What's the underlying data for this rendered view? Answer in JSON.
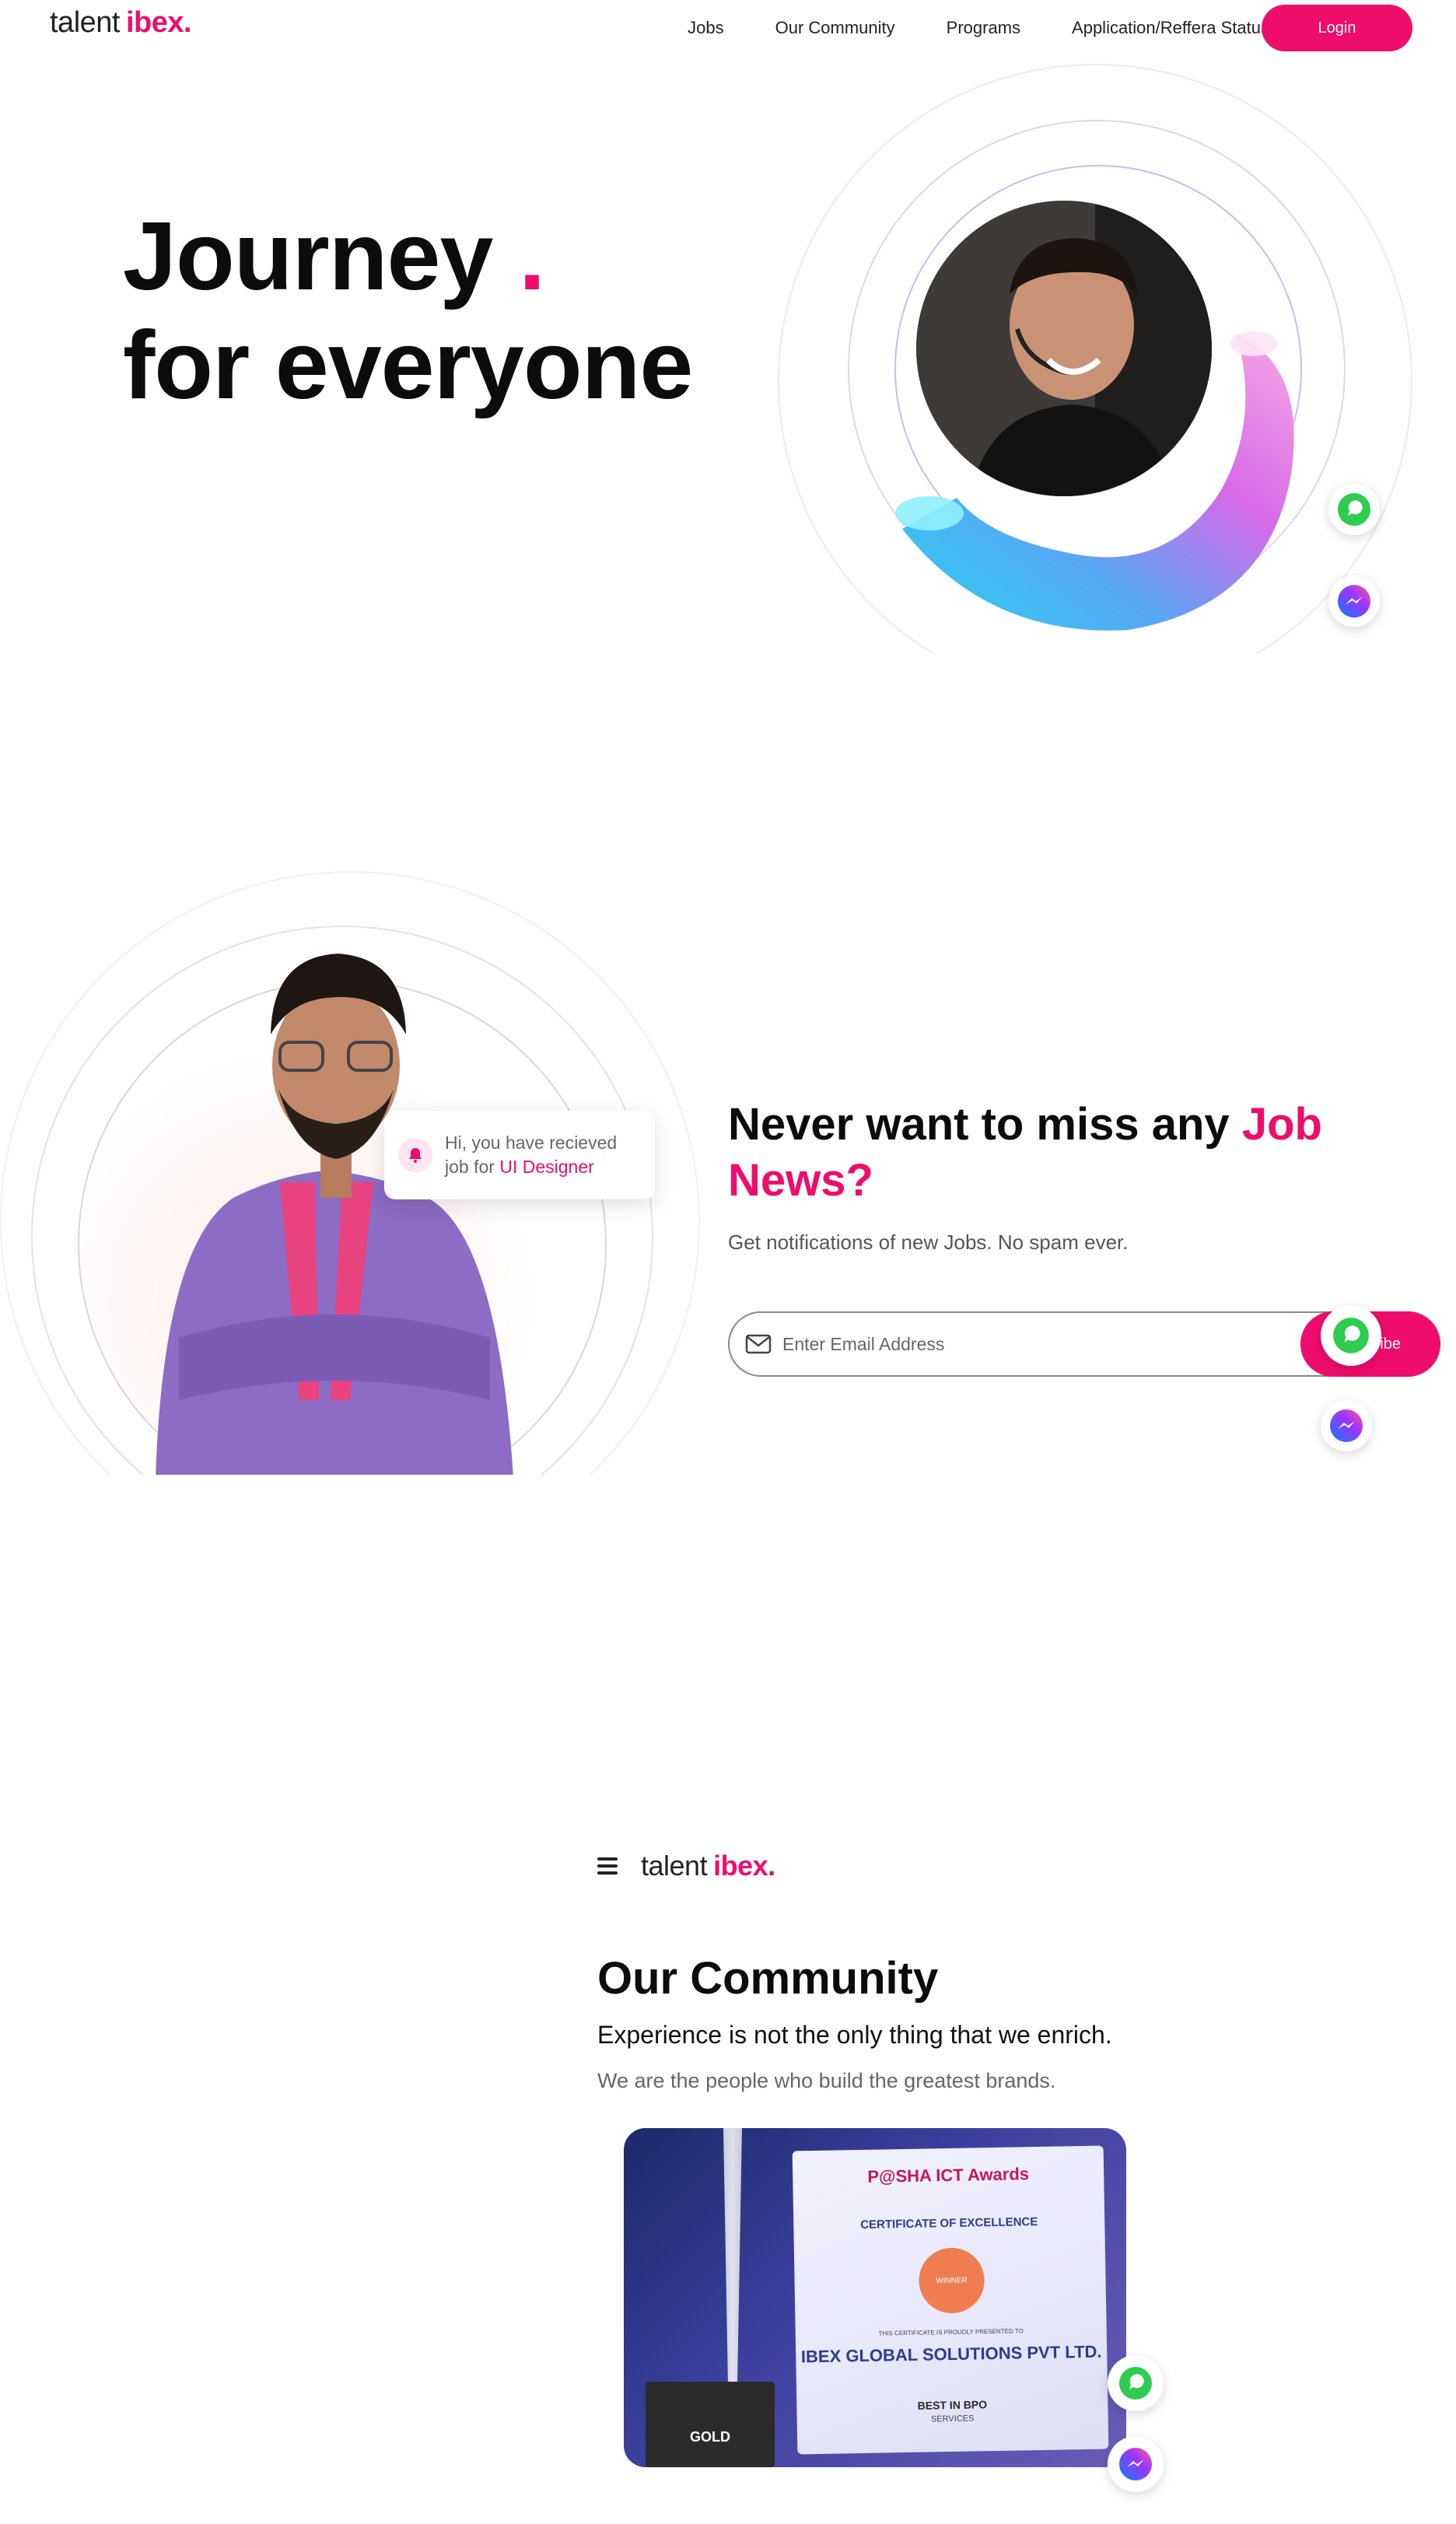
{
  "brand": {
    "name_light": "talent",
    "name_bold": "ibex."
  },
  "nav": {
    "links": [
      "Jobs",
      "Our Community",
      "Programs",
      "Application/Reffera Status"
    ],
    "login_label": "Login"
  },
  "hero": {
    "line1": "Journey",
    "dot": ".",
    "line2": "for everyone"
  },
  "newsletter": {
    "notification": {
      "prefix": "Hi, you have recieved job for ",
      "highlight": "UI Designer"
    },
    "title_plain": "Never want to miss any ",
    "title_highlight": "Job News?",
    "subtitle": "Get notifications of new Jobs. No spam ever.",
    "email_placeholder": "Enter Email Address",
    "subscribe_label": "Subscribe"
  },
  "community": {
    "title": "Our Community",
    "subtitle": "Experience is not the only thing that we enrich.",
    "description": "We are the people who build the greatest brands.",
    "certificate": {
      "header": "P@SHA ICT Awards",
      "cert_title": "CERTIFICATE OF EXCELLENCE",
      "badge": "WINNER",
      "presented": "THIS CERTIFICATE IS PROUDLY PRESENTED TO",
      "company": "IBEX GLOBAL SOLUTIONS PVT LTD.",
      "category": "BEST IN BPO",
      "category2": "SERVICES",
      "trophy_label": "GOLD"
    }
  },
  "floating": {
    "whatsapp": "whatsapp-icon",
    "messenger": "messenger-icon"
  },
  "colors": {
    "accent": "#ee0d6b",
    "text": "#0c0c0c",
    "muted": "#666666"
  }
}
